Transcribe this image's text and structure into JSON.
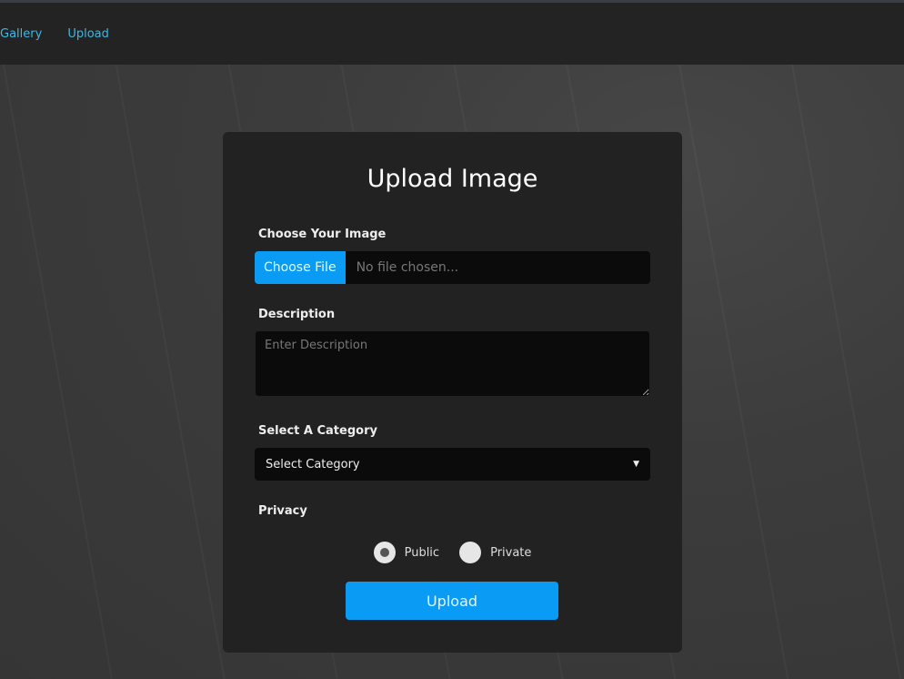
{
  "nav": {
    "items": [
      {
        "label": "Gallery"
      },
      {
        "label": "Upload"
      }
    ]
  },
  "form": {
    "title": "Upload Image",
    "image_label": "Choose Your Image",
    "choose_file_label": "Choose File",
    "file_status": "No file chosen...",
    "description_label": "Description",
    "description_placeholder": "Enter Description",
    "category_label": "Select A Category",
    "category_selected": "Select Category",
    "privacy_label": "Privacy",
    "privacy_options": [
      {
        "label": "Public",
        "checked": true
      },
      {
        "label": "Private",
        "checked": false
      }
    ],
    "submit_label": "Upload"
  },
  "colors": {
    "accent": "#0a9bf4",
    "nav_link": "#3fb7e0"
  }
}
